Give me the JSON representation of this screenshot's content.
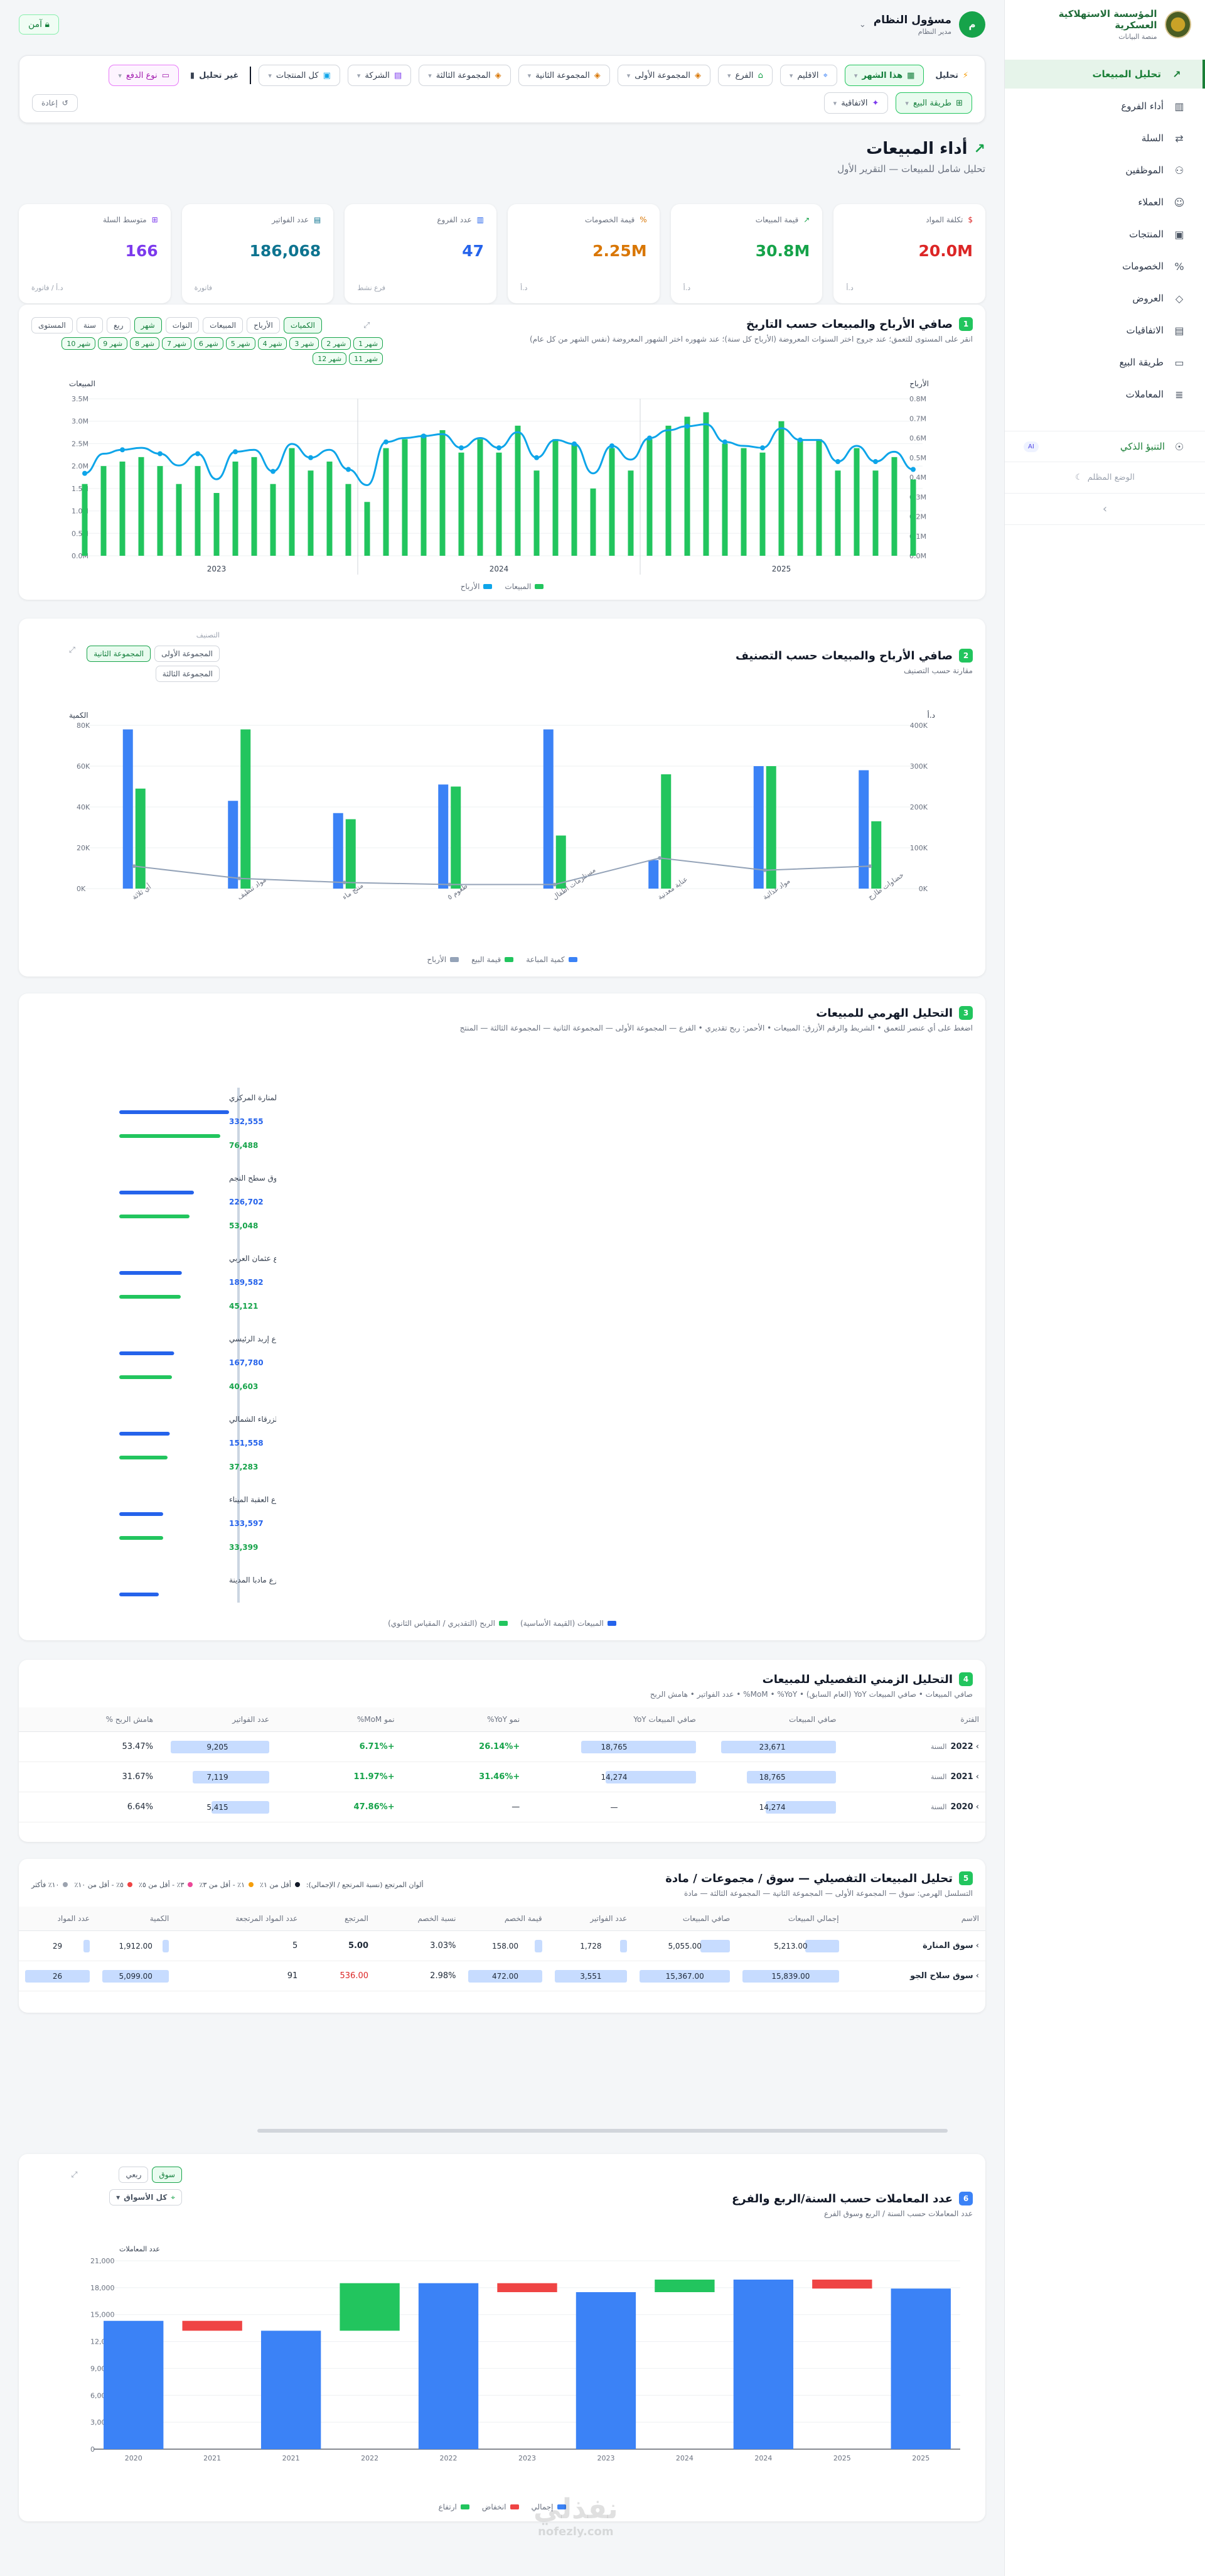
{
  "brand": {
    "title": "المؤسسة الاستهلاكية العسكرية",
    "subtitle": "منصة البيانات"
  },
  "sidebar": {
    "items": [
      {
        "label": "تحليل المبيعات",
        "icon": "trend-icon",
        "active": true
      },
      {
        "label": "أداء الفروع",
        "icon": "building-icon"
      },
      {
        "label": "السلة",
        "icon": "route-icon"
      },
      {
        "label": "الموظفين",
        "icon": "users-icon"
      },
      {
        "label": "العملاء",
        "icon": "user-icon"
      },
      {
        "label": "المنتجات",
        "icon": "box-icon"
      },
      {
        "label": "الخصومات",
        "icon": "percent-icon"
      },
      {
        "label": "العروض",
        "icon": "tag-icon"
      },
      {
        "label": "الاتفاقيات",
        "icon": "document-icon"
      },
      {
        "label": "طريقة البيع",
        "icon": "card-icon"
      },
      {
        "label": "المعاملات",
        "icon": "receipt-icon"
      }
    ],
    "ai_label": "التنبؤ الذكي",
    "ai_badge": "AI",
    "mode_label": "الوضع المظلم"
  },
  "user": {
    "initial": "م",
    "name": "مسؤول النظام",
    "role": "مدير النظام"
  },
  "secure_label": "آمن",
  "filters": {
    "period_label": "تحليل",
    "period_value": "هذا الشهر",
    "region": "الاقليم",
    "branch": "الفرع",
    "group1": "المجموعة الأولى",
    "group2": "المجموعة الثانية",
    "group3": "المجموعة الثالثة",
    "company": "الشركة",
    "products": "كل المنتجات",
    "compare_label": "غير تحليل",
    "payment": "نوع الدفع",
    "sale_method": "طريقة البيع",
    "agreement": "الاتفاقية",
    "reset": "إعادة"
  },
  "page": {
    "title": "أداء المبيعات",
    "subtitle": "تحليل شامل للمبيعات — التقرير الأول"
  },
  "kpis": [
    {
      "label": "تكلفة المواد",
      "value": "20.0M",
      "unit": "د.أ",
      "color": "#dc2626"
    },
    {
      "label": "قيمة المبيعات",
      "value": "30.8M",
      "unit": "د.أ",
      "color": "#16a34a"
    },
    {
      "label": "قيمة الخصومات",
      "value": "2.25M",
      "unit": "د.أ",
      "color": "#d97706"
    },
    {
      "label": "عدد الفروع",
      "value": "47",
      "unit": "فرع نشط",
      "color": "#2563eb"
    },
    {
      "label": "عدد الفواتير",
      "value": "186,068",
      "unit": "فاتورة",
      "color": "#0e7490"
    },
    {
      "label": "متوسط السلة",
      "value": "166",
      "unit": "د.أ / فاتورة",
      "color": "#7c3aed"
    }
  ],
  "chart1": {
    "num": "1",
    "title": "صافي الأرباح والمبيعات حسب التاريخ",
    "subtitle": "انقر على المستوى للتعمق؛ عند جروج اختر السنوات المعروضة (الأرباح كل سنة)؛ عند شهوره اختر الشهور المعروضة (نفس الشهر من كل عام)",
    "metric_toggles": [
      "الكميات",
      "الأرباح",
      "المبيعات",
      "النوات"
    ],
    "level_toggles": [
      "شهر",
      "ربع",
      "سنة",
      "المستوى"
    ],
    "month_chips": [
      "شهر 1",
      "شهر 2",
      "شهر 3",
      "شهر 4",
      "شهر 5",
      "شهر 6",
      "شهر 7",
      "شهر 8",
      "شهر 9",
      "شهر 10",
      "شهر 11",
      "شهر 12"
    ]
  },
  "chart1_data": {
    "type": "bar+line",
    "left_axis_label": "المبيعات",
    "right_axis_label": "الأرباح",
    "left_ticks": [
      "3.5M",
      "3.0M",
      "2.5M",
      "2.0M",
      "1.5M",
      "1.0M",
      "0.5M",
      "0.0M"
    ],
    "right_ticks": [
      "0.8M",
      "0.7M",
      "0.6M",
      "0.5M",
      "0.4M",
      "0.3M",
      "0.2M",
      "0.1M",
      "0.0M"
    ],
    "years": [
      "2023",
      "2024",
      "2025"
    ],
    "sales": [
      1.6,
      2.0,
      2.1,
      2.2,
      2.0,
      1.6,
      2.0,
      1.4,
      2.1,
      2.2,
      1.6,
      2.4,
      1.9,
      2.1,
      1.6,
      1.2,
      2.4,
      2.6,
      2.7,
      2.8,
      2.3,
      2.6,
      2.3,
      2.9,
      1.9,
      2.6,
      2.5,
      1.5,
      2.4,
      1.9,
      2.6,
      2.9,
      3.1,
      3.2,
      2.5,
      2.4,
      2.3,
      3.0,
      2.6,
      2.6,
      1.9,
      2.4,
      1.9,
      2.2,
      1.7
    ],
    "profit": [
      0.42,
      0.52,
      0.54,
      0.55,
      0.52,
      0.46,
      0.52,
      0.39,
      0.53,
      0.54,
      0.43,
      0.57,
      0.5,
      0.54,
      0.44,
      0.36,
      0.58,
      0.6,
      0.61,
      0.62,
      0.55,
      0.6,
      0.55,
      0.63,
      0.5,
      0.59,
      0.57,
      0.42,
      0.56,
      0.49,
      0.6,
      0.64,
      0.66,
      0.67,
      0.58,
      0.56,
      0.55,
      0.65,
      0.59,
      0.59,
      0.48,
      0.56,
      0.48,
      0.53,
      0.44
    ],
    "legend": [
      "المبيعات",
      "الأرباح"
    ],
    "colors": {
      "sales": "#22c55e",
      "profit": "#0ea5e9"
    }
  },
  "chart2": {
    "num": "2",
    "title": "صافي الأرباح والمبيعات حسب التصنيف",
    "subtitle": "مقارنة حسب التصنيف",
    "corner_label": "التصنيف",
    "toggles": [
      "المجموعة الأولى",
      "المجموعة الثانية",
      "المجموعة الثالثة"
    ]
  },
  "chart2_data": {
    "type": "bar+line",
    "left_axis_label": "الكمية",
    "right_axis_label": "د.أ",
    "left_ticks": [
      "80K",
      "60K",
      "40K",
      "20K",
      "0K"
    ],
    "right_ticks": [
      "400K",
      "300K",
      "200K",
      "100K",
      "0K"
    ],
    "categories": [
      "أي ثلاثة",
      "مواد تنظيف",
      "منتج ماء",
      "طعوم ٥",
      "مستلزمات أطفال",
      "عناية معدنية",
      "مواد غذائية",
      "خضاوات طازج"
    ],
    "quantity": [
      78,
      43,
      37,
      51,
      78,
      14,
      60,
      58
    ],
    "sales": [
      49,
      78,
      34,
      50,
      26,
      56,
      60,
      33
    ],
    "profit": [
      11,
      5,
      3,
      2,
      2,
      15,
      9,
      11
    ],
    "legend": [
      "كمية المباعة",
      "قيمة البيع",
      "الأرباح"
    ]
  },
  "chart3": {
    "num": "3",
    "title": "التحليل الهرمي للمبيعات",
    "subtitle": "اضغط على أي عنصر للتعمق • الشريط والرقم الأزرق: المبيعات • الأحمر: ربح تقديري • الفرع — المجموعة الأولى — المجموعة الثانية — المجموعة الثالثة — المنتج",
    "axis_label": "الفرع",
    "items": [
      {
        "name": "سوق المنارة المركزي",
        "sales": "332,555",
        "profit": "76,488",
        "s": 1.0,
        "p": 0.23
      },
      {
        "name": "سوق سطح النجم",
        "sales": "226,702",
        "profit": "53,048",
        "s": 0.68,
        "p": 0.16
      },
      {
        "name": "فرع عثمان العربي",
        "sales": "189,582",
        "profit": "45,121",
        "s": 0.57,
        "p": 0.14
      },
      {
        "name": "فرع إربد الرئيسي",
        "sales": "167,780",
        "profit": "40,603",
        "s": 0.5,
        "p": 0.12
      },
      {
        "name": "فرع الزرقاء الشمالي",
        "sales": "151,558",
        "profit": "37,283",
        "s": 0.46,
        "p": 0.11
      },
      {
        "name": "فرع العقبة الميناء",
        "sales": "133,597",
        "profit": "33,399",
        "s": 0.4,
        "p": 0.1
      },
      {
        "name": "فرع مادبا المدينة",
        "sales": "",
        "profit": "",
        "s": 0.36,
        "p": 0
      }
    ],
    "legend": [
      "المبيعات (القيمة الأساسية)",
      "الربح (التقديري / المقياس الثانوي)"
    ]
  },
  "chart4": {
    "num": "4",
    "title": "التحليل الزمني التفصيلي للمبيعات",
    "subtitle": "صافي المبيعات • صافي المبيعات YoY (العام السابق) • MoM • %YoY% • عدد الفواتير • هامش الربح",
    "columns": [
      "الفترة",
      "صافي المبيعات",
      "صافي المبيعات YoY",
      "نمو YoY%",
      "نمو MoM%",
      "عدد الفواتير",
      "هامش الربح %"
    ],
    "rows": [
      {
        "year": "2022",
        "label": "السنة",
        "sales": "23,671",
        "sales_f": 0.9,
        "yoy": "18,765",
        "yoy_f": 0.7,
        "yoyp": "+26.14%",
        "mom": "+6.71%",
        "inv": "9,205",
        "inv_f": 0.95,
        "margin": "53.47%"
      },
      {
        "year": "2021",
        "label": "السنة",
        "sales": "18,765",
        "sales_f": 0.7,
        "yoy": "14,274",
        "yoy_f": 0.55,
        "yoyp": "+31.46%",
        "mom": "+11.97%",
        "inv": "7,119",
        "inv_f": 0.74,
        "margin": "31.67%"
      },
      {
        "year": "2020",
        "label": "السنة",
        "sales": "14,274",
        "sales_f": 0.55,
        "yoy": "—",
        "yoy_f": 0,
        "yoyp": "—",
        "mom": "+47.86%",
        "inv": "5,415",
        "inv_f": 0.56,
        "margin": "6.64%"
      }
    ]
  },
  "chart5": {
    "num": "5",
    "title": "تحليل المبيعات التفصيلي — سوق / مجموعات / مادة",
    "subtitle": "التسلسل الهرمي: سوق — المجموعة الأولى — المجموعة الثانية — المجموعة الثالثة — مادة",
    "legend_title": "ألوان المرتجع (نسبة المرتجع / الإجمالي):",
    "legend": [
      "أقل من ١٪",
      "١٪ - أقل من ٣٪",
      "٣٪ - أقل من ٥٪",
      "٥٪ - أقل من ١٠٪",
      "١٠٪ فأكثر"
    ],
    "legend_colors": [
      "#111827",
      "#f59e0b",
      "#ec4899",
      "#ef4444",
      "#9ca3af"
    ],
    "columns": [
      "الاسم",
      "إجمالي المبيعات",
      "صافي المبيعات",
      "عدد الفواتير",
      "قيمة الخصم",
      "نسبة الخصم",
      "المرتجع",
      "عدد المواد المرتجعة",
      "الكمية",
      "عدد المواد"
    ],
    "rows": [
      {
        "name": "سوق المنارة",
        "total": "5,213.00",
        "net": "5,055.00",
        "inv": "1,728",
        "disc": "158.00",
        "discp": "3.03%",
        "ret": "5.00",
        "retn": "5",
        "qty": "1,912.00",
        "items": "29"
      },
      {
        "name": "سوق سلاح الجو",
        "total": "15,839.00",
        "net": "15,367.00",
        "inv": "3,551",
        "disc": "472.00",
        "discp": "2.98%",
        "ret": "536.00",
        "retn": "91",
        "qty": "5,099.00",
        "items": "26"
      }
    ]
  },
  "chart6": {
    "num": "6",
    "title": "عدد المعاملات حسب السنة/الربع والفرع",
    "subtitle": "عدد المعاملات حسب السنة / الربع وسوق الفرع",
    "toggles": [
      "سوق",
      "ربعي"
    ],
    "select": "كل الأسواق",
    "axis_label": "عدد المعاملات",
    "legend": [
      "إجمالي",
      "انخفاض",
      "ارتفاع"
    ]
  },
  "chart6_data": {
    "type": "waterfall",
    "ticks": [
      "21,000",
      "18,000",
      "15,000",
      "12,000",
      "9,000",
      "6,000",
      "3,000",
      "0"
    ],
    "x": [
      "2020",
      "2021",
      "2021",
      "2022",
      "2022",
      "2023",
      "2023",
      "2024",
      "2024",
      "2025",
      "2025"
    ],
    "steps": [
      {
        "kind": "total",
        "to": 14300
      },
      {
        "kind": "down",
        "from": 14300,
        "to": 13200
      },
      {
        "kind": "total",
        "to": 13200
      },
      {
        "kind": "up",
        "from": 13200,
        "to": 18500
      },
      {
        "kind": "total",
        "to": 18500
      },
      {
        "kind": "down",
        "from": 18500,
        "to": 17500
      },
      {
        "kind": "total",
        "to": 17500
      },
      {
        "kind": "up",
        "from": 17500,
        "to": 18900
      },
      {
        "kind": "total",
        "to": 18900
      },
      {
        "kind": "down",
        "from": 18900,
        "to": 17900
      },
      {
        "kind": "total",
        "to": 17900
      }
    ],
    "colors": {
      "total": "#3b82f6",
      "down": "#ef4444",
      "up": "#22c55e"
    }
  },
  "watermark": {
    "ar": "نفذلي",
    "en": "nofezly.com"
  }
}
